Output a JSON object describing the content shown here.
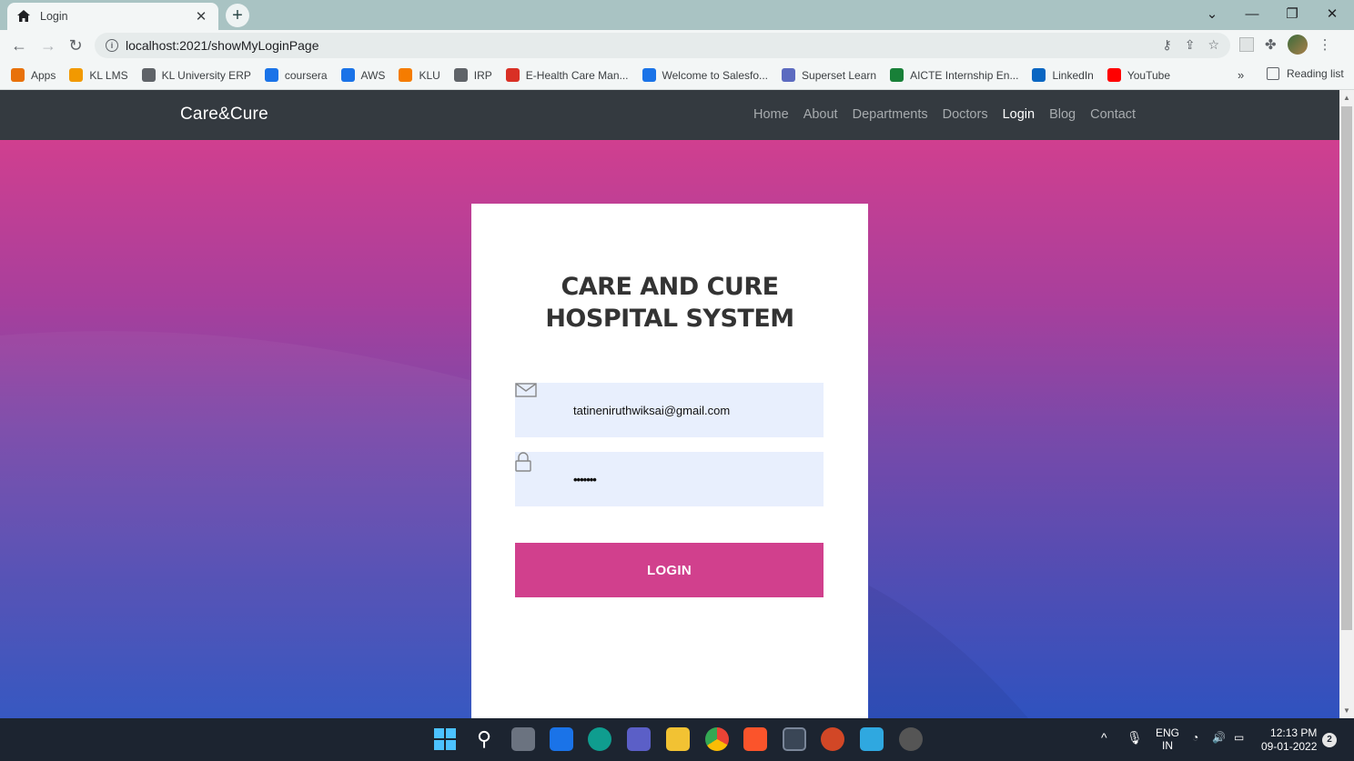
{
  "browser": {
    "tab_title": "Login",
    "url": "localhost:2021/showMyLoginPage",
    "bookmarks": [
      {
        "label": "Apps",
        "color": "#e8710a"
      },
      {
        "label": "KL LMS",
        "color": "#f29900"
      },
      {
        "label": "KL University ERP",
        "color": "#5f6368"
      },
      {
        "label": "coursera",
        "color": "#1a73e8"
      },
      {
        "label": "AWS",
        "color": "#1a73e8"
      },
      {
        "label": "KLU",
        "color": "#f57c00"
      },
      {
        "label": "IRP",
        "color": "#5f6368"
      },
      {
        "label": "E-Health Care Man...",
        "color": "#d93025"
      },
      {
        "label": "Welcome to Salesfo...",
        "color": "#1a73e8"
      },
      {
        "label": "Superset Learn",
        "color": "#5c6bc0"
      },
      {
        "label": "AICTE Internship En...",
        "color": "#188038"
      },
      {
        "label": "LinkedIn",
        "color": "#0a66c2"
      },
      {
        "label": "YouTube",
        "color": "#ff0000"
      }
    ],
    "bookmarks_more": "»",
    "reading_list": "Reading list"
  },
  "site": {
    "brand": "Care&Cure",
    "nav": [
      {
        "label": "Home",
        "active": false
      },
      {
        "label": "About",
        "active": false
      },
      {
        "label": "Departments",
        "active": false
      },
      {
        "label": "Doctors",
        "active": false
      },
      {
        "label": "Login",
        "active": true
      },
      {
        "label": "Blog",
        "active": false
      },
      {
        "label": "Contact",
        "active": false
      }
    ]
  },
  "login": {
    "title_line1": "CARE AND CURE",
    "title_line2": "HOSPITAL SYSTEM",
    "email_value": "tatineniruthwiksai@gmail.com",
    "password_value": "•••••••",
    "button_label": "LOGIN"
  },
  "taskbar": {
    "lang_top": "ENG",
    "lang_bottom": "IN",
    "time": "12:13 PM",
    "date": "09-01-2022",
    "notifications": "2"
  },
  "colors": {
    "accent": "#d1408d",
    "navbar": "#343a40",
    "input_bg": "#e8effd"
  }
}
